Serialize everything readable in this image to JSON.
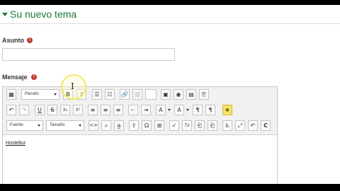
{
  "section": {
    "title": "Su nuevo tema"
  },
  "form": {
    "subject_label": "Asunto",
    "message_label": "Mensaje",
    "required_mark": "!",
    "subject_value": ""
  },
  "editor": {
    "paragraph_select": "Párrafo",
    "font_select": "Fuente",
    "size_select": "Tamaño",
    "content": "Hosteltur",
    "toolbar_row1": [
      {
        "name": "toggle-toolbar-icon",
        "glyph": "▦"
      },
      {
        "name": "bold-button",
        "glyph": "B"
      },
      {
        "name": "italic-button",
        "glyph": "I"
      },
      {
        "name": "bullet-list-icon",
        "glyph": "☰"
      },
      {
        "name": "numbered-list-icon",
        "glyph": "☷"
      },
      {
        "name": "link-icon",
        "glyph": "🔗"
      },
      {
        "name": "unlink-icon",
        "glyph": "⛓"
      },
      {
        "name": "image-icon",
        "glyph": "▣"
      },
      {
        "name": "media-icon",
        "glyph": "◉"
      },
      {
        "name": "record-icon",
        "glyph": "▤"
      },
      {
        "name": "files-icon",
        "glyph": "⎘"
      }
    ],
    "toolbar_row2": [
      {
        "name": "undo-icon",
        "glyph": "↶"
      },
      {
        "name": "redo-icon",
        "glyph": "↷"
      },
      {
        "name": "underline-button",
        "glyph": "U"
      },
      {
        "name": "strikethrough-button",
        "glyph": "S"
      },
      {
        "name": "subscript-button",
        "glyph": "X₂"
      },
      {
        "name": "superscript-button",
        "glyph": "X²"
      },
      {
        "name": "align-left-icon",
        "glyph": "≡"
      },
      {
        "name": "align-center-icon",
        "glyph": "≡"
      },
      {
        "name": "align-right-icon",
        "glyph": "≡"
      },
      {
        "name": "outdent-icon",
        "glyph": "⇤"
      },
      {
        "name": "indent-icon",
        "glyph": "⇥"
      },
      {
        "name": "text-color-icon",
        "glyph": "A"
      },
      {
        "name": "background-color-icon",
        "glyph": "A"
      },
      {
        "name": "ltr-icon",
        "glyph": "¶"
      },
      {
        "name": "rtl-icon",
        "glyph": "¶"
      },
      {
        "name": "accessibility-icon",
        "glyph": "●"
      }
    ],
    "toolbar_row3": [
      {
        "name": "code-icon",
        "glyph": "<>"
      },
      {
        "name": "find-replace-icon",
        "glyph": "⌕"
      },
      {
        "name": "spell-check-icon",
        "glyph": "a̲"
      },
      {
        "name": "upload-icon",
        "glyph": "⇪"
      },
      {
        "name": "special-char-icon",
        "glyph": "Ω"
      },
      {
        "name": "table-icon",
        "glyph": "⊞"
      },
      {
        "name": "clean-icon",
        "glyph": "✓"
      },
      {
        "name": "clear-format-icon",
        "glyph": "Tx"
      },
      {
        "name": "paste-text-icon",
        "glyph": "⎗"
      },
      {
        "name": "paste-word-icon",
        "glyph": "⎗"
      },
      {
        "name": "screenreader-icon",
        "glyph": "♿"
      },
      {
        "name": "fullscreen-icon",
        "glyph": "⤢"
      },
      {
        "name": "html-source-icon",
        "glyph": "↶"
      },
      {
        "name": "c-icon",
        "glyph": "C"
      }
    ]
  }
}
